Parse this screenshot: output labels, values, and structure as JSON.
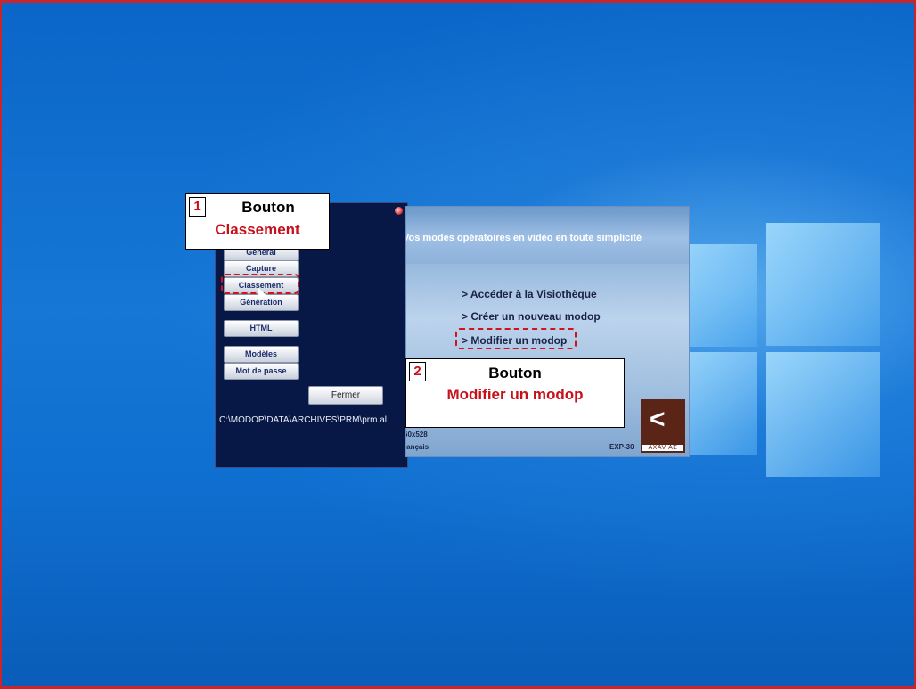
{
  "settings_window": {
    "buttons": [
      "Général",
      "Capture",
      "Classement",
      "Génération",
      "HTML",
      "Modèles",
      "Mot de passe"
    ],
    "close_label": "Fermer",
    "path": "C:\\MODOP\\DATA\\ARCHIVES\\PRM\\prm.al"
  },
  "splash": {
    "title": "Vos modes opératoires en vidéo en toute simplicité",
    "links": [
      "> Accéder à la Visiothèque",
      "> Créer un nouveau modop",
      "> Modifier un modop"
    ],
    "resolution": "60x528",
    "language": "rançais",
    "version": "EXP-30",
    "brand": "AXAVIAE"
  },
  "callouts": [
    {
      "number": "1",
      "line1": "Bouton",
      "line2": "Classement"
    },
    {
      "number": "2",
      "line1": "Bouton",
      "line2": "Modifier un modop"
    }
  ],
  "colors": {
    "accent_red": "#c8101b",
    "desktop_blue": "#0c63c8",
    "settings_bg": "#081846"
  }
}
